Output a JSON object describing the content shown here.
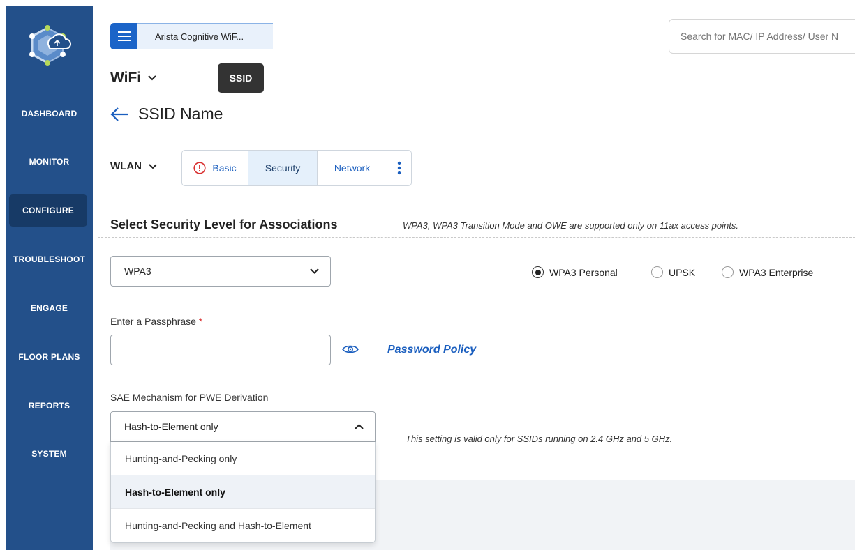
{
  "sidebar": {
    "items": [
      {
        "label": "DASHBOARD"
      },
      {
        "label": "MONITOR"
      },
      {
        "label": "CONFIGURE",
        "active": true
      },
      {
        "label": "TROUBLESHOOT"
      },
      {
        "label": "ENGAGE"
      },
      {
        "label": "FLOOR PLANS"
      },
      {
        "label": "REPORTS"
      },
      {
        "label": "SYSTEM"
      }
    ]
  },
  "header": {
    "breadcrumb": "Arista Cognitive WiF...",
    "search_placeholder": "Search for MAC/ IP Address/ User N",
    "section": "WiFi",
    "badge": "SSID"
  },
  "page": {
    "title": "SSID Name"
  },
  "tabs": {
    "group_label": "WLAN",
    "items": [
      {
        "label": "Basic",
        "icon": "alert-circle-icon"
      },
      {
        "label": "Security",
        "active": true
      },
      {
        "label": "Network"
      }
    ]
  },
  "security": {
    "title": "Select Security Level for Associations",
    "note": "WPA3, WPA3 Transition Mode and OWE are supported only on 11ax access points.",
    "selected": "WPA3",
    "radios": [
      {
        "label": "WPA3 Personal",
        "checked": true
      },
      {
        "label": "UPSK",
        "checked": false
      },
      {
        "label": "WPA3 Enterprise",
        "checked": false
      }
    ]
  },
  "passphrase": {
    "label": "Enter a Passphrase",
    "required_mark": "*",
    "value": "",
    "policy_link": "Password Policy"
  },
  "sae": {
    "label": "SAE Mechanism for PWE Derivation",
    "selected": "Hash-to-Element only",
    "note": "This setting is valid only for SSIDs running on 2.4 GHz and 5 GHz.",
    "options": [
      "Hunting-and-Pecking only",
      "Hash-to-Element only",
      "Hunting-and-Pecking and Hash-to-Element"
    ]
  },
  "colors": {
    "sidebar": "#23508a",
    "sidebar_active": "#173a66",
    "accent": "#1b64c8",
    "link": "#1b5fbf",
    "required": "#d93030"
  }
}
